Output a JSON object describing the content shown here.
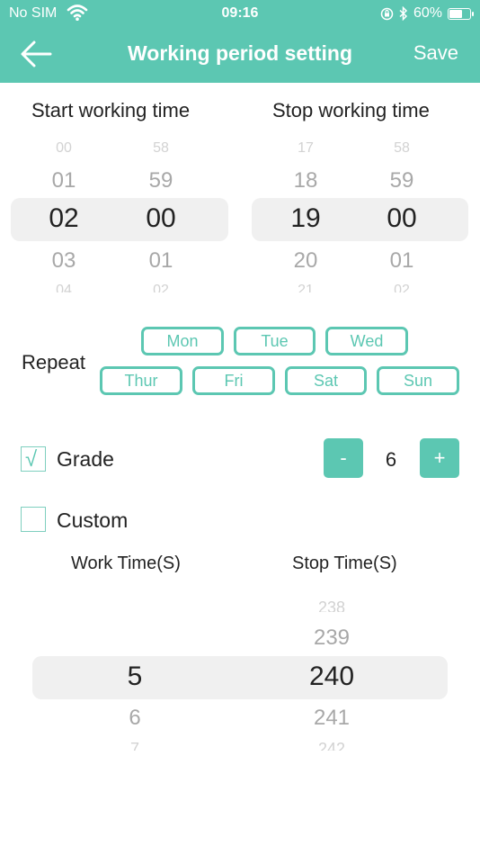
{
  "status_bar": {
    "carrier": "No SIM",
    "time": "09:16",
    "battery": "60%",
    "battery_level": 0.6,
    "icons": [
      "wifi-icon",
      "orientation-lock-icon",
      "bluetooth-icon",
      "battery-icon"
    ]
  },
  "header": {
    "title": "Working period setting",
    "save_label": "Save",
    "back_icon": "arrow-left-icon",
    "color": "#5cc7b2"
  },
  "start": {
    "label": "Start working time",
    "hours": {
      "edge_top": "00",
      "prev": "01",
      "selected": "02",
      "next": "03",
      "edge_bottom": "04"
    },
    "minutes": {
      "edge_top": "58",
      "prev": "59",
      "selected": "00",
      "next": "01",
      "edge_bottom": "02"
    }
  },
  "stop": {
    "label": "Stop working time",
    "hours": {
      "edge_top": "17",
      "prev": "18",
      "selected": "19",
      "next": "20",
      "edge_bottom": "21"
    },
    "minutes": {
      "edge_top": "58",
      "prev": "59",
      "selected": "00",
      "next": "01",
      "edge_bottom": "02"
    }
  },
  "repeat": {
    "label": "Repeat",
    "days": [
      "Mon",
      "Tue",
      "Wed",
      "Thur",
      "Fri",
      "Sat",
      "Sun"
    ]
  },
  "grade": {
    "label": "Grade",
    "checked": true,
    "check_mark": "√",
    "minus_label": "-",
    "plus_label": "+",
    "value": "6"
  },
  "custom": {
    "label": "Custom",
    "checked": false,
    "work_time_label": "Work Time(S)",
    "stop_time_label": "Stop Time(S)",
    "work": {
      "edge_top": "",
      "prev": "",
      "selected": "5",
      "next": "6",
      "edge_bottom": "7"
    },
    "stop": {
      "edge_top": "238",
      "prev": "239",
      "selected": "240",
      "next": "241",
      "edge_bottom": "242"
    }
  },
  "colors": {
    "accent": "#5cc7b2",
    "band": "#f0f0f0",
    "faded": "#a8a8a8"
  }
}
